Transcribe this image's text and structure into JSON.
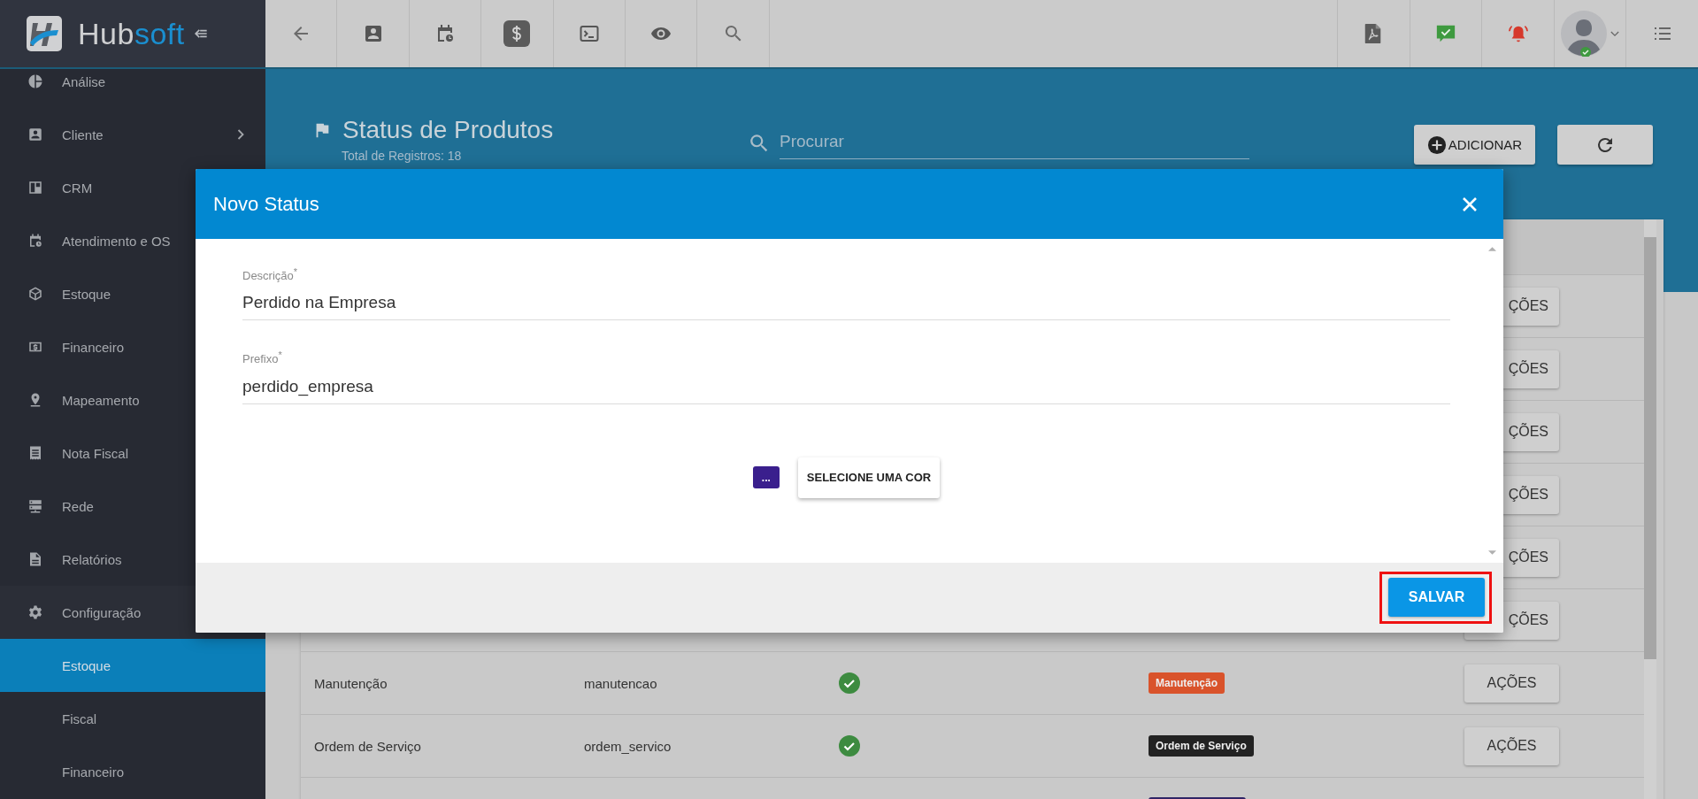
{
  "brand": {
    "first": "Hub",
    "second": "soft"
  },
  "sidebar": {
    "items": [
      {
        "label": "Análise",
        "selected": false
      },
      {
        "label": "Cliente",
        "selected": false,
        "expanded": false
      },
      {
        "label": "CRM",
        "selected": false
      },
      {
        "label": "Atendimento e OS",
        "selected": false
      },
      {
        "label": "Estoque",
        "selected": false
      },
      {
        "label": "Financeiro",
        "selected": false
      },
      {
        "label": "Mapeamento",
        "selected": false
      },
      {
        "label": "Nota Fiscal",
        "selected": false
      },
      {
        "label": "Rede",
        "selected": false
      },
      {
        "label": "Relatórios",
        "selected": false
      },
      {
        "label": "Configuração",
        "selected": false,
        "expanded": true,
        "children": [
          {
            "label": "Estoque",
            "selected": true
          },
          {
            "label": "Fiscal",
            "selected": false
          },
          {
            "label": "Financeiro",
            "selected": false
          }
        ]
      }
    ]
  },
  "page": {
    "title": "Status de Produtos",
    "subtitle": "Total de Registros: 18",
    "search": {
      "placeholder": "Procurar"
    },
    "add_button": "ADICIONAR"
  },
  "table": {
    "rows": [
      {
        "action": "ÇÕES"
      },
      {
        "action": "ÇÕES"
      },
      {
        "action": "ÇÕES"
      },
      {
        "action": "ÇÕES"
      },
      {
        "action": "ÇÕES"
      },
      {
        "action": "ÇÕES"
      },
      {
        "name": "Manutenção",
        "prefix": "manutencao",
        "active": true,
        "badge": "Manutenção",
        "color": "#d9532b",
        "action": "AÇÕES"
      },
      {
        "name": "Ordem de Serviço",
        "prefix": "ordem_servico",
        "active": true,
        "badge": "Ordem de Serviço",
        "color": "#222222",
        "action": "AÇÕES"
      },
      {
        "color": "#2f2466"
      }
    ]
  },
  "dialog": {
    "title": "Novo Status",
    "fields": [
      {
        "label": "Descrição$^{*}$",
        "value": "Perdido na Empresa"
      },
      {
        "label": "Prefixo$^{*}$",
        "value": "perdido_empresa"
      }
    ],
    "color_picker": {
      "swatch_label": "...",
      "color": "#3a1f8d",
      "button": "SELECIONE UMA COR"
    },
    "save_button": {
      "label": "SALVAR",
      "highlighted": true
    }
  }
}
